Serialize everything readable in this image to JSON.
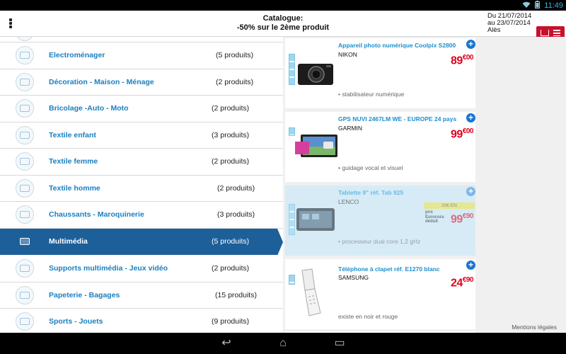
{
  "status": {
    "time": "11:49",
    "icons": [
      "wifi-icon",
      "battery-icon"
    ]
  },
  "header": {
    "title_line1": "Catalogue:",
    "title_line2": "-50% sur le 2ème produit",
    "date_from": "Du 21/07/2014",
    "date_to": "au 23/07/2014",
    "store": "Alès",
    "accent_color": "#c8102e"
  },
  "categories": [
    {
      "label": "Electroménager",
      "count": "(5 produits)"
    },
    {
      "label": "Décoration - Maison - Ménage",
      "count": "(2 produits)"
    },
    {
      "label": "Bricolage -Auto - Moto",
      "count": "(2 produits)"
    },
    {
      "label": "Textile enfant",
      "count": "(3 produits)"
    },
    {
      "label": "Textile femme",
      "count": "(2 produits)"
    },
    {
      "label": "Textile homme",
      "count": "(2 produits)"
    },
    {
      "label": "Chaussants -  Maroquinerie",
      "count": "(3 produits)"
    },
    {
      "label": "Multimédia",
      "count": "(5 produits)",
      "active": true
    },
    {
      "label": "Supports multimédia - Jeux vidéo",
      "count": "(2 produits)"
    },
    {
      "label": "Papeterie - Bagages",
      "count": "(15 produits)"
    },
    {
      "label": "Sports - Jouets",
      "count": "(9 produits)"
    }
  ],
  "products": [
    {
      "name": "Appareil photo numérique Coolpix S2800",
      "brand": "NIKON",
      "price_int": "89",
      "price_dec": "€00",
      "feature": "• stabilisateur numérique"
    },
    {
      "name": "GPS NUVI 2467LM WE - EUROPE 24 pays",
      "brand": "GARMIN",
      "price_int": "99",
      "price_dec": "€00",
      "feature": "• guidage vocal et visuel"
    },
    {
      "name": "Tablette 9\" réf. Tab 925",
      "brand": "LENCO",
      "price_int": "99",
      "price_dec": "€90",
      "feature": "• processeur dual core 1,2 gHz",
      "promo": "20€ EN",
      "promo_note": [
        "prix",
        "Eurocora",
        "déduit"
      ]
    },
    {
      "name": "Téléphone à clapet réf. E1270 blanc",
      "brand": "SAMSUNG",
      "price_int": "24",
      "price_dec": "€90",
      "feature": "existe en noir et rouge"
    }
  ],
  "footer": {
    "mentions": "Mentions légales"
  },
  "nav": {
    "back": "↩",
    "home": "⌂",
    "recents": "▭"
  }
}
